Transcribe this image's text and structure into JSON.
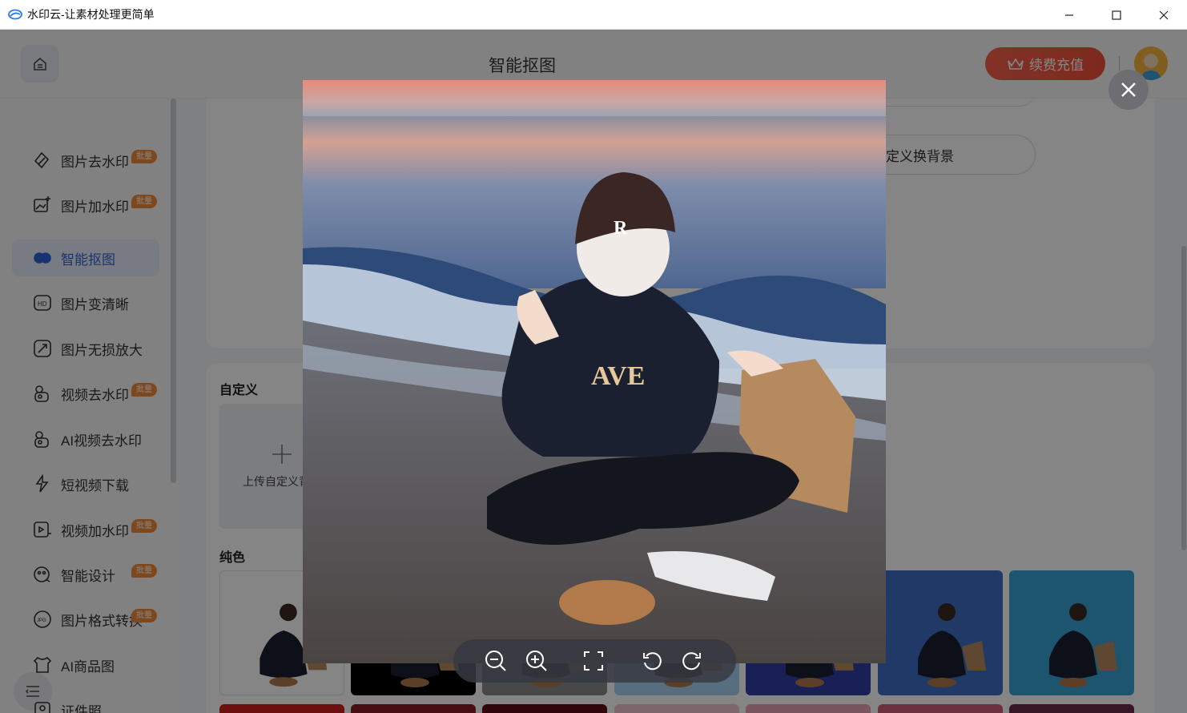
{
  "window": {
    "title": "水印云-让素材处理更简单",
    "controls": [
      "minimize-icon",
      "maximize-icon",
      "close-icon"
    ]
  },
  "header": {
    "home_icon": "home-icon",
    "page_title": "智能抠图",
    "vip_button": "续费充值",
    "vip_icon": "crown-icon"
  },
  "sidebar": {
    "items": [
      {
        "label": "图片去水印",
        "icon": "eraser-icon",
        "badge": "批量",
        "active": false
      },
      {
        "label": "图片加水印",
        "icon": "image-add-icon",
        "badge": "批量",
        "active": false
      },
      {
        "label": "智能抠图",
        "icon": "cutout-icon",
        "badge": "",
        "active": true
      },
      {
        "label": "图片变清晰",
        "icon": "hd-icon",
        "badge": "",
        "active": false
      },
      {
        "label": "图片无损放大",
        "icon": "enlarge-icon",
        "badge": "",
        "active": false
      },
      {
        "label": "视频去水印",
        "icon": "video-eraser-icon",
        "badge": "批量",
        "active": false
      },
      {
        "label": "AI视频去水印",
        "icon": "ai-video-icon",
        "badge": "",
        "active": false
      },
      {
        "label": "短视频下载",
        "icon": "download-icon",
        "badge": "",
        "active": false
      },
      {
        "label": "视频加水印",
        "icon": "video-add-icon",
        "badge": "批量",
        "active": false
      },
      {
        "label": "智能设计",
        "icon": "design-icon",
        "badge": "批量",
        "active": false
      },
      {
        "label": "图片格式转换",
        "icon": "jpg-icon",
        "badge": "批量",
        "active": false
      },
      {
        "label": "AI商品图",
        "icon": "shirt-icon",
        "badge": "",
        "active": false
      },
      {
        "label": "证件照",
        "icon": "id-photo-icon",
        "badge": "",
        "active": false
      }
    ]
  },
  "main": {
    "custom_bg_button": "定义换背景",
    "custom_section_title": "自定义",
    "upload_label": "上传自定义背景",
    "solid_section_title": "纯色",
    "swatches_row1": [
      "#ffffff",
      "#000000",
      "#8a8a8a",
      "#a8d4f5",
      "#2f3ea6",
      "#3f6ec4",
      "#3aa3d4"
    ],
    "swatches_row2": [
      "#d01e1e",
      "#8c1c24",
      "#5e0d14",
      "#f0c6d0",
      "#e8a6b4",
      "#d05c7a",
      "#6a2c48"
    ]
  },
  "preview": {
    "close_icon": "close-icon",
    "tools": [
      "zoom-out-icon",
      "zoom-in-icon",
      "fit-screen-icon",
      "rotate-left-icon",
      "rotate-right-icon"
    ]
  },
  "colors": {
    "accent_blue": "#2e62d9",
    "vip_red": "#f0513a",
    "badge_orange": "#f28b3c"
  }
}
